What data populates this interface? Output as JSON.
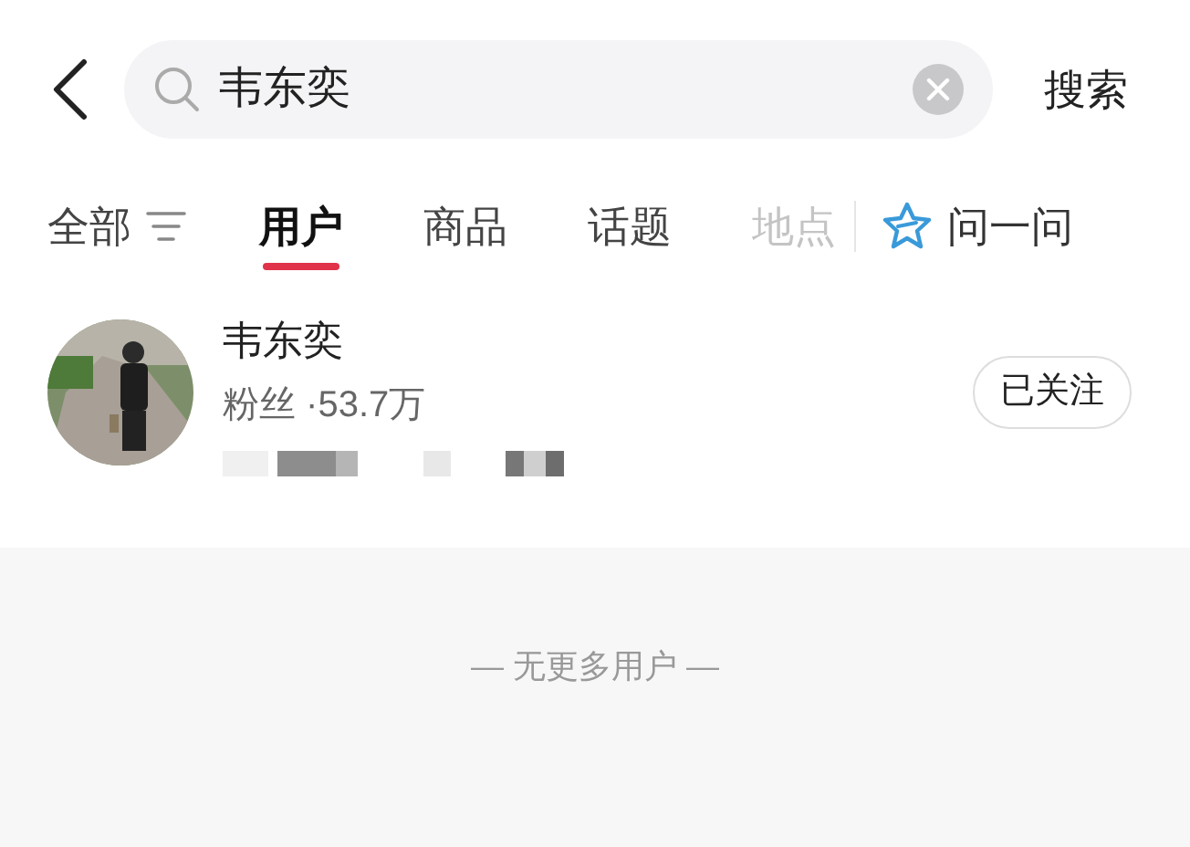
{
  "search": {
    "value": "韦东奕",
    "button": "搜索"
  },
  "tabs": [
    {
      "label": "全部",
      "kind": "filter",
      "selected": false,
      "faded": false
    },
    {
      "label": "用户",
      "kind": "plain",
      "selected": true,
      "faded": false
    },
    {
      "label": "商品",
      "kind": "plain",
      "selected": false,
      "faded": false
    },
    {
      "label": "话题",
      "kind": "plain",
      "selected": false,
      "faded": false
    },
    {
      "label": "地点",
      "kind": "plain",
      "selected": false,
      "faded": true
    }
  ],
  "ask": {
    "label": "问一问"
  },
  "results": [
    {
      "name": "韦东奕",
      "fans": "粉丝 ·53.7万",
      "follow": "已关注"
    }
  ],
  "footer": "— 无更多用户 —"
}
